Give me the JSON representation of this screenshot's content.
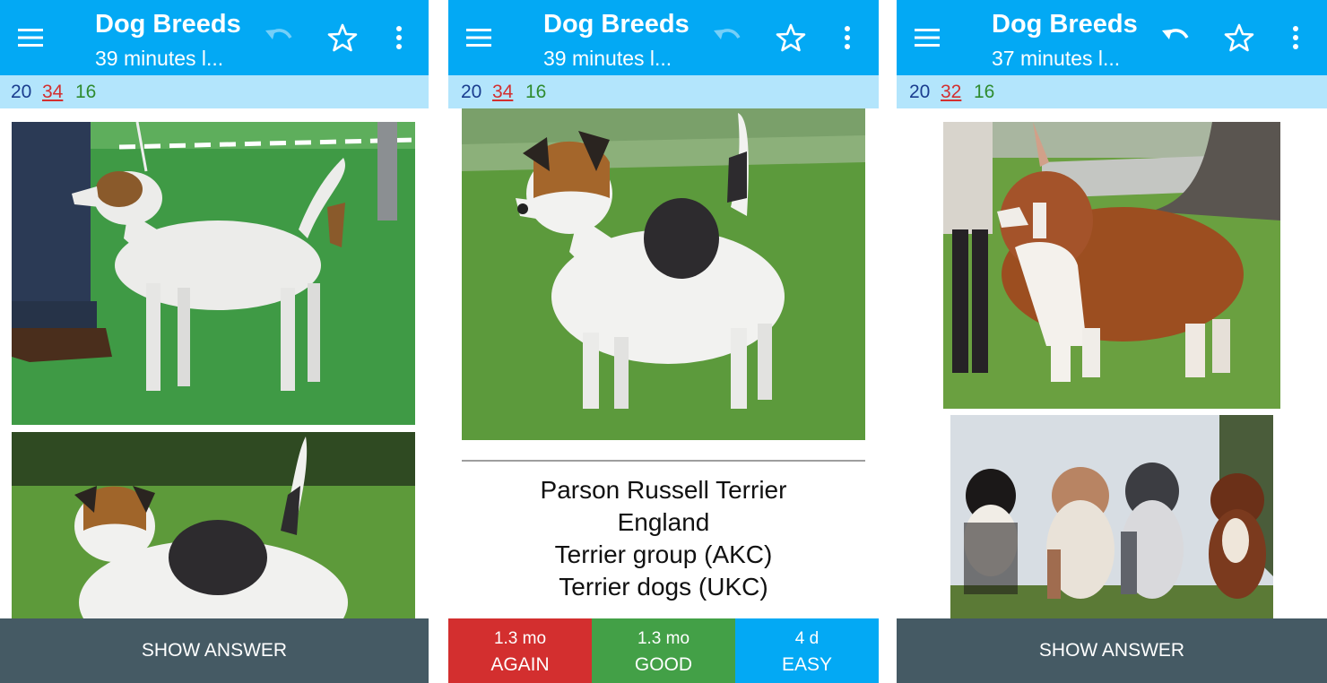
{
  "screens": [
    {
      "title": "Dog Breeds",
      "subtitle": "39 minutes l...",
      "counts": {
        "new": "20",
        "learning": "34",
        "review": "16"
      },
      "undo_enabled": false,
      "bottom_button": "SHOW ANSWER",
      "images": [
        "parson-russell-terrier-side-photo",
        "parson-russell-terrier-front-photo"
      ]
    },
    {
      "title": "Dog Breeds",
      "subtitle": "39 minutes l...",
      "counts": {
        "new": "20",
        "learning": "34",
        "review": "16"
      },
      "undo_enabled": false,
      "images": [
        "parson-russell-terrier-photo"
      ],
      "answer": {
        "lines": [
          "Parson Russell Terrier",
          "England",
          "Terrier group (AKC)",
          "Terrier dogs (UKC)"
        ]
      },
      "ease_buttons": [
        {
          "interval": "1.3 mo",
          "label": "AGAIN",
          "color": "#d32f2f"
        },
        {
          "interval": "1.3 mo",
          "label": "GOOD",
          "color": "#43a047"
        },
        {
          "interval": "4 d",
          "label": "EASY",
          "color": "#03a9f4"
        }
      ]
    },
    {
      "title": "Dog Breeds",
      "subtitle": "37 minutes l...",
      "counts": {
        "new": "20",
        "learning": "32",
        "review": "16"
      },
      "undo_enabled": true,
      "bottom_button": "SHOW ANSWER",
      "images": [
        "australian-shepherd-photo",
        "four-australian-shepherds-photo"
      ]
    }
  ],
  "colors": {
    "toolbar": "#03a9f4",
    "count_bar": "#b3e5fc",
    "new_count": "#1a3d8f",
    "learning_count": "#d32f2f",
    "review_count": "#2e8b2e",
    "show_answer": "#455a64"
  }
}
